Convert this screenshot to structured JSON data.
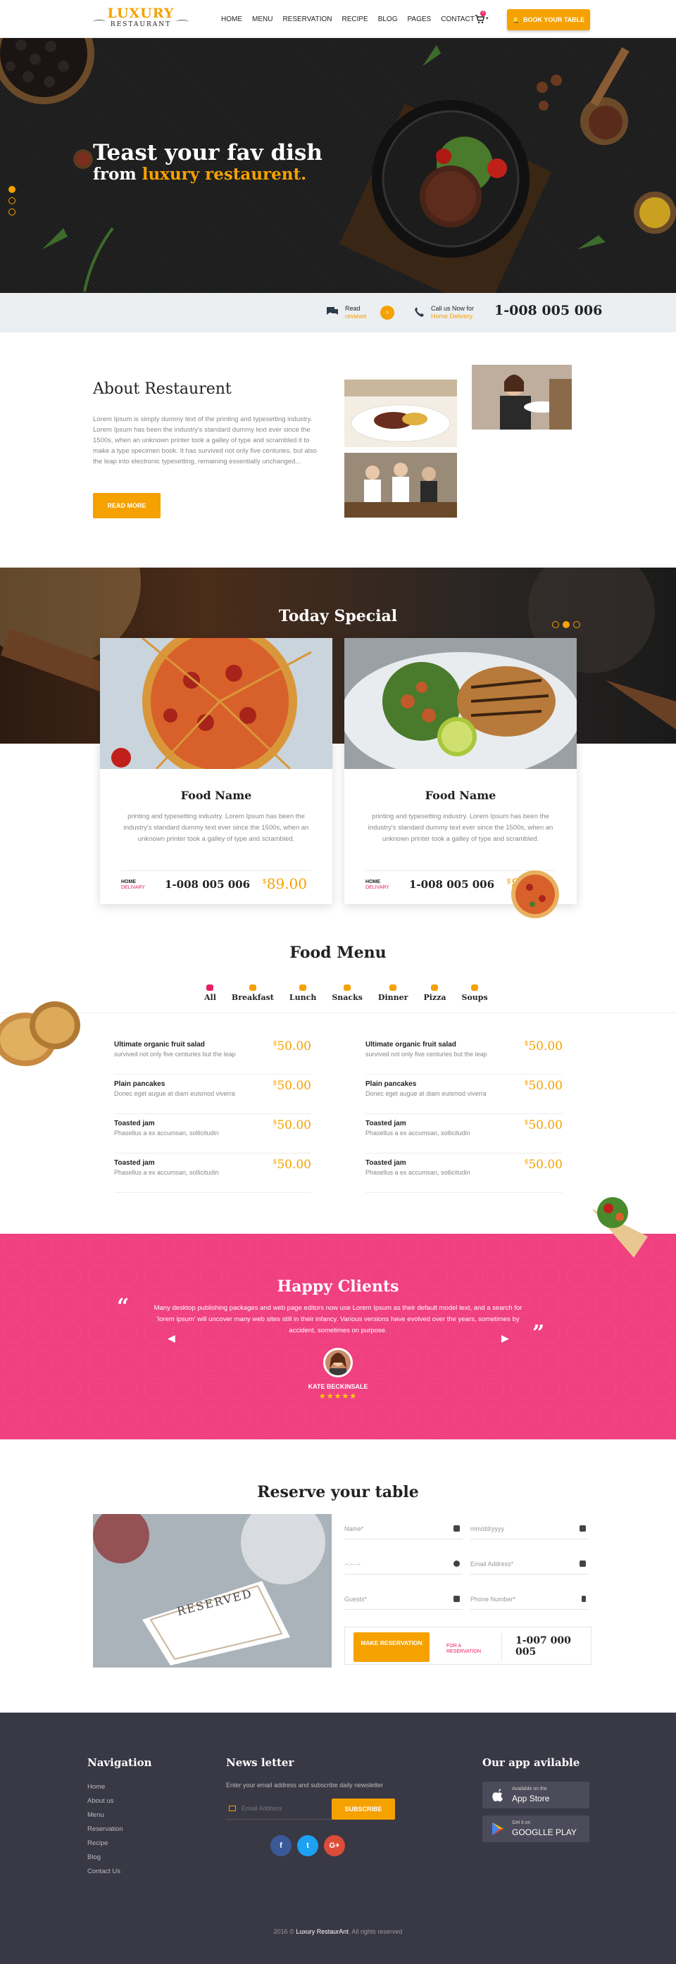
{
  "header": {
    "logo_line1": "LUXURY",
    "logo_line2": "RESTAURANT",
    "nav": [
      "HOME",
      "MENU",
      "RESERVATION",
      "RECIPE",
      "BLOG",
      "PAGES",
      "CONTACT"
    ],
    "cart_count": "0",
    "book_button": "BOOK YOUR TABLE"
  },
  "hero": {
    "title": "Teast your fav dish",
    "subtitle_prefix": "from ",
    "subtitle_highlight": "luxury restaurent."
  },
  "infobar": {
    "read_label": "Read",
    "read_sub": "reviews",
    "call_label": "Call us Now for",
    "call_sub": "Home Delivery",
    "phone": "1-008 005 006"
  },
  "about": {
    "title": "About Restaurent",
    "text": "Lorem Ipsum is simply dummy text of the printing and typesetting industry. Lorem Ipsum has been the industry's standard dummy text ever since the 1500s, when an unknown printer took a galley of type and scrambled it to make a type specimen book. It has survived not only five centuries, but also the leap into electronic typesetting, remaining essentially unchanged...",
    "button": "READ MORE"
  },
  "special": {
    "title": "Today Special",
    "cards": [
      {
        "name": "Food Name",
        "desc": "printing and typesetting industry. Lorem Ipsum has been the industry's standard dummy text ever since the 1500s, when an unknown printer took a galley of type and scrambled.",
        "home": "HOME",
        "delivery": "DELIVARY",
        "phone": "1-008 005 006",
        "currency": "$",
        "price": "89.00"
      },
      {
        "name": "Food Name",
        "desc": "printing and typesetting industry. Lorem Ipsum has been the industry's standard dummy text ever since the 1500s, when an unknown printer took a galley of type and scrambled.",
        "home": "HOME",
        "delivery": "DELIVARY",
        "phone": "1-008 005 006",
        "currency": "$",
        "price": "89.00"
      }
    ]
  },
  "food_menu": {
    "title": "Food Menu",
    "tabs": [
      "All",
      "Breakfast",
      "Lunch",
      "Snacks",
      "Dinner",
      "Pizza",
      "Soups"
    ],
    "left": [
      {
        "title": "Ultimate organic fruit salad",
        "desc": "survived not only five centuries but the leap",
        "currency": "$",
        "price": "50.00"
      },
      {
        "title": "Plain pancakes",
        "desc": "Donec eget augue at diam euismod viverra",
        "currency": "$",
        "price": "50.00"
      },
      {
        "title": "Toasted jam",
        "desc": "Phasellus a ex accumsan, sollicitudin",
        "currency": "$",
        "price": "50.00"
      },
      {
        "title": "Toasted jam",
        "desc": "Phasellus a ex accumsan, sollicitudin",
        "currency": "$",
        "price": "50.00"
      }
    ],
    "right": [
      {
        "title": "Ultimate organic fruit salad",
        "desc": "survived not only five centuries but the leap",
        "currency": "$",
        "price": "50.00"
      },
      {
        "title": "Plain pancakes",
        "desc": "Donec eget augue at diam euismod viverra",
        "currency": "$",
        "price": "50.00"
      },
      {
        "title": "Toasted jam",
        "desc": "Phasellus a ex accumsan, sollicitudin",
        "currency": "$",
        "price": "50.00"
      },
      {
        "title": "Toasted jam",
        "desc": "Phasellus a ex accumsan, sollicitudin",
        "currency": "$",
        "price": "50.00"
      }
    ]
  },
  "clients": {
    "title": "Happy Clients",
    "text": "Many desktop publishing packages and web page editors now use Lorem Ipsum as their default model text, and a search for 'lorem ipsum' will uncover many web sites still in their infancy. Various versions have evolved over the years, sometimes by accident, sometimes on purpose.",
    "name": "KATE BECKINSALE",
    "stars": "★★★★★",
    "rating": 5
  },
  "reserve": {
    "title": "Reserve your table",
    "card_text": "RESERVED",
    "fields": {
      "name": "Name*",
      "date": "mm/dd/yyyy",
      "time": "--:-- --",
      "email": "Email Address*",
      "guests": "Guests*",
      "phone": "Phone Number*"
    },
    "button": "MAKE RESERVATION",
    "for_label": "FOR A",
    "for_sub": "RESERVATION",
    "phone": "1-007 000 005"
  },
  "footer": {
    "nav_title": "Navigation",
    "nav": [
      "Home",
      "About us",
      "Menu",
      "Reservation",
      "Recipe",
      "Blog",
      "Contact Us"
    ],
    "news_title": "News letter",
    "news_text": "Enter your email address and subscribe daily newsletter",
    "email_placeholder": "Email Address",
    "subscribe": "SUBSCRIBE",
    "app_title": "Our app avilable",
    "appstore_small": "Available on the",
    "appstore_big": "App Store",
    "google_small": "Get it on",
    "google_big": "GOOGLLE PLAY",
    "copy_prefix": "2016 © ",
    "copy_brand": "Luxury RestaurAnt",
    "copy_suffix": ". All rights reserved"
  },
  "colors": {
    "accent": "#f5a100",
    "pink": "#f0407f",
    "footer": "#393845"
  }
}
